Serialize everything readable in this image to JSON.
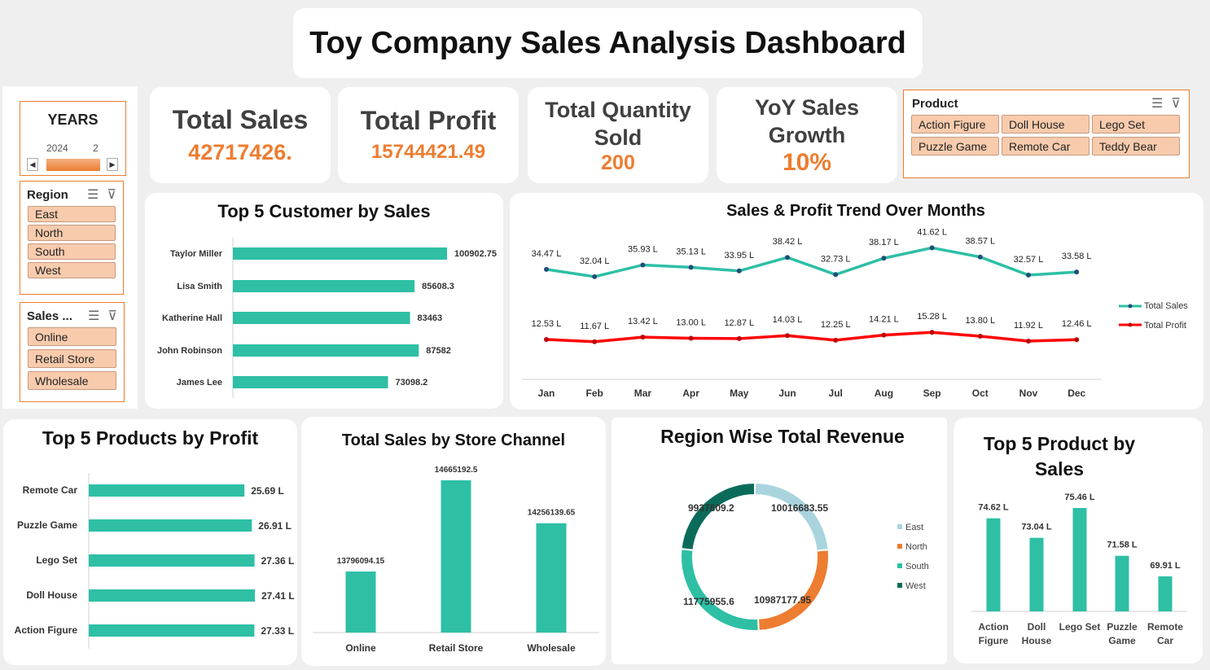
{
  "title": "Toy Company Sales Analysis Dashboard",
  "kpis": {
    "total_sales_label": "Total Sales",
    "total_sales_value": "42717426.",
    "total_profit_label": "Total Profit",
    "total_profit_value": "15744421.49",
    "total_qty_label_1": "Total Quantity",
    "total_qty_label_2": "Sold",
    "total_qty_value": "200",
    "yoy_label_1": "YoY Sales",
    "yoy_label_2": "Growth",
    "yoy_value": "10%"
  },
  "slicers": {
    "years": {
      "title": "YEARS",
      "year": "2024",
      "extra": "2"
    },
    "region": {
      "title": "Region",
      "items": [
        "East",
        "North",
        "South",
        "West"
      ]
    },
    "sales_channel": {
      "title": "Sales ...",
      "items": [
        "Online",
        "Retail Store",
        "Wholesale"
      ]
    },
    "product": {
      "title": "Product",
      "items": [
        "Action Figure",
        "Doll House",
        "Lego Set",
        "Puzzle Game",
        "Remote Car",
        "Teddy Bear"
      ]
    }
  },
  "colors": {
    "accent": "#ed7d31",
    "teal": "#2ebfa5",
    "red": "#ff0000",
    "slicer": "#f8cbad",
    "light_blue": "#a9d4de",
    "dark_teal": "#0b6b5b"
  },
  "chart_data": [
    {
      "id": "top_customers",
      "type": "bar",
      "orientation": "horizontal",
      "title": "Top 5 Customer by Sales",
      "categories": [
        "Taylor Miller",
        "Lisa Smith",
        "Katherine Hall",
        "John Robinson",
        "James Lee"
      ],
      "values": [
        100902.75,
        85608.3,
        83463,
        87582,
        73098.2
      ],
      "labels": [
        "100902.75",
        "85608.3",
        "83463",
        "87582",
        "73098.2"
      ]
    },
    {
      "id": "trend",
      "type": "line",
      "title": "Sales & Profit Trend Over Months",
      "categories": [
        "Jan",
        "Feb",
        "Mar",
        "Apr",
        "May",
        "Jun",
        "Jul",
        "Aug",
        "Sep",
        "Oct",
        "Nov",
        "Dec"
      ],
      "series": [
        {
          "name": "Total Sales",
          "values": [
            34.47,
            32.04,
            35.93,
            35.13,
            33.95,
            38.42,
            32.73,
            38.17,
            41.62,
            38.57,
            32.57,
            33.58
          ],
          "labels": [
            "34.47 L",
            "32.04 L",
            "35.93 L",
            "35.13 L",
            "33.95 L",
            "38.42 L",
            "32.73 L",
            "38.17 L",
            "41.62 L",
            "38.57 L",
            "32.57 L",
            "33.58 L"
          ]
        },
        {
          "name": "Total Profit",
          "values": [
            12.53,
            11.67,
            13.42,
            13.0,
            12.87,
            14.03,
            12.25,
            14.21,
            15.28,
            13.8,
            11.92,
            12.46
          ],
          "labels": [
            "12.53 L",
            "11.67 L",
            "13.42 L",
            "13.00 L",
            "12.87 L",
            "14.03 L",
            "12.25 L",
            "14.21 L",
            "15.28 L",
            "13.80 L",
            "11.92 L",
            "12.46 L"
          ]
        }
      ],
      "legend": "right"
    },
    {
      "id": "top_products_profit",
      "type": "bar",
      "orientation": "horizontal",
      "title": "Top 5 Products by Profit",
      "categories": [
        "Remote Car",
        "Puzzle Game",
        "Lego Set",
        "Doll House",
        "Action Figure"
      ],
      "values": [
        25.69,
        26.91,
        27.36,
        27.41,
        27.33
      ],
      "labels": [
        "25.69 L",
        "26.91 L",
        "27.36 L",
        "27.41 L",
        "27.33 L"
      ]
    },
    {
      "id": "channel",
      "type": "bar",
      "title": "Total Sales by Store Channel",
      "categories": [
        "Online",
        "Retail Store",
        "Wholesale"
      ],
      "values": [
        13796094.15,
        14665192.5,
        14256139.65
      ],
      "labels": [
        "13796094.15",
        "14665192.5",
        "14256139.65"
      ]
    },
    {
      "id": "region",
      "type": "pie",
      "donut": true,
      "title": "Region Wise Total Revenue",
      "categories": [
        "East",
        "North",
        "South",
        "West"
      ],
      "values": [
        10016683.55,
        10987177.95,
        11775955.6,
        9937609.2
      ],
      "labels": [
        "10016683.55",
        "10987177.95",
        "11775955.6",
        "9937609.2"
      ],
      "colors": [
        "#a9d4de",
        "#ed7d31",
        "#2ebfa5",
        "#0b6b5b"
      ],
      "legend": "right"
    },
    {
      "id": "top_products_sales",
      "type": "bar",
      "title_line1": "Top 5 Product by",
      "title_line2": "Sales",
      "categories": [
        [
          "Action",
          "Figure"
        ],
        [
          "Doll",
          "House"
        ],
        [
          "Lego Set",
          ""
        ],
        [
          "Puzzle",
          "Game"
        ],
        [
          "Remote",
          "Car"
        ]
      ],
      "values": [
        74.62,
        73.04,
        75.46,
        71.58,
        69.91
      ],
      "labels": [
        "74.62 L",
        "73.04 L",
        "75.46 L",
        "71.58 L",
        "69.91 L"
      ]
    }
  ]
}
